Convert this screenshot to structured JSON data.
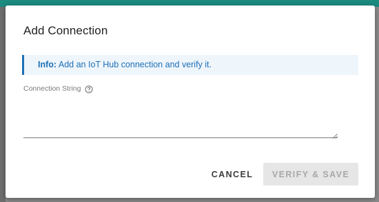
{
  "dialog": {
    "title": "Add Connection",
    "info": {
      "prefix": "Info:",
      "message": "Add an IoT Hub connection and verify it."
    },
    "connection_string": {
      "label": "Connection String",
      "value": "",
      "help_icon": "question-circle-icon"
    },
    "buttons": {
      "cancel": "CANCEL",
      "verify_save": "VERIFY & SAVE"
    }
  },
  "colors": {
    "accent": "#1e6fb5",
    "info_background": "#eef5fb",
    "disabled_button_bg": "#e6e6e6",
    "disabled_button_text": "#a8a8a8",
    "backdrop_teal": "#1b8a7f"
  }
}
